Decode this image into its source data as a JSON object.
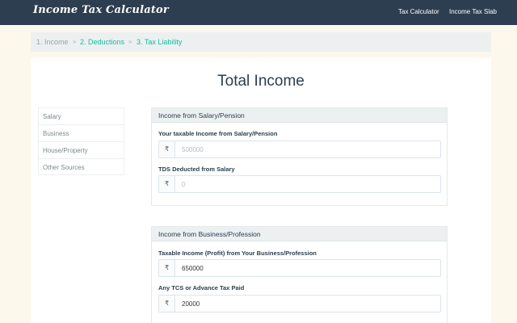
{
  "app": {
    "brand": "Income Tax Calculator",
    "nav": [
      {
        "label": "Tax Calculator"
      },
      {
        "label": "Income Tax Slab"
      }
    ]
  },
  "breadcrumb": {
    "steps": [
      "1. Income",
      "2. Deductions",
      "3. Tax Liability"
    ],
    "separator": "»"
  },
  "page": {
    "title": "Total Income"
  },
  "sidebar": {
    "items": [
      {
        "label": "Salary"
      },
      {
        "label": "Business"
      },
      {
        "label": "House/Property"
      },
      {
        "label": "Other Sources"
      }
    ]
  },
  "sections": {
    "salary": {
      "title": "Income from Salary/Pension",
      "fields": [
        {
          "label": "Your taxable Income from Salary/Pension",
          "prefix": "₹",
          "value": "",
          "placeholder": "500000"
        },
        {
          "label": "TDS Deducted from Salary",
          "prefix": "₹",
          "value": "",
          "placeholder": "0"
        }
      ]
    },
    "business": {
      "title": "Income from Business/Profession",
      "fields": [
        {
          "label": "Taxable Income (Profit) from Your Business/Profession",
          "prefix": "₹",
          "value": "650000",
          "placeholder": ""
        },
        {
          "label": "Any TCS or Advance Tax Paid",
          "prefix": "₹",
          "value": "20000",
          "placeholder": ""
        }
      ]
    }
  },
  "colors": {
    "navbar": "#2c3e50",
    "accent": "#18bc9c",
    "page_background": "#fdf8ec"
  }
}
